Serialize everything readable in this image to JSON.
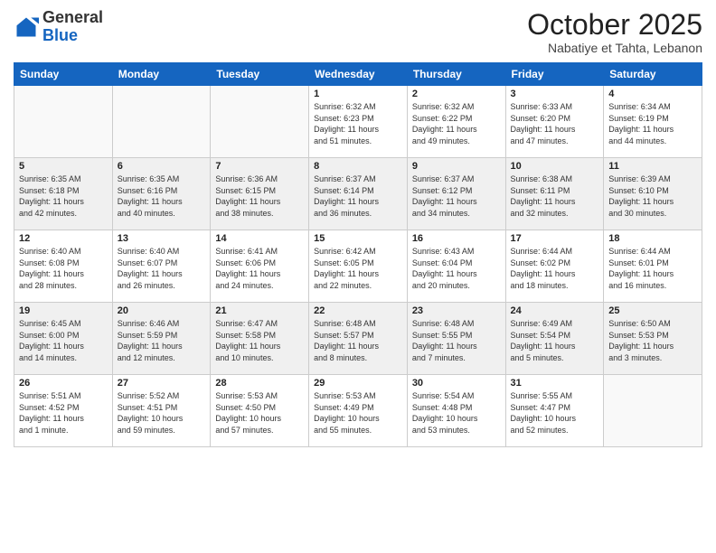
{
  "header": {
    "logo_general": "General",
    "logo_blue": "Blue",
    "month_title": "October 2025",
    "subtitle": "Nabatiye et Tahta, Lebanon"
  },
  "days_of_week": [
    "Sunday",
    "Monday",
    "Tuesday",
    "Wednesday",
    "Thursday",
    "Friday",
    "Saturday"
  ],
  "weeks": [
    {
      "shaded": false,
      "days": [
        {
          "number": "",
          "info": ""
        },
        {
          "number": "",
          "info": ""
        },
        {
          "number": "",
          "info": ""
        },
        {
          "number": "1",
          "info": "Sunrise: 6:32 AM\nSunset: 6:23 PM\nDaylight: 11 hours\nand 51 minutes."
        },
        {
          "number": "2",
          "info": "Sunrise: 6:32 AM\nSunset: 6:22 PM\nDaylight: 11 hours\nand 49 minutes."
        },
        {
          "number": "3",
          "info": "Sunrise: 6:33 AM\nSunset: 6:20 PM\nDaylight: 11 hours\nand 47 minutes."
        },
        {
          "number": "4",
          "info": "Sunrise: 6:34 AM\nSunset: 6:19 PM\nDaylight: 11 hours\nand 44 minutes."
        }
      ]
    },
    {
      "shaded": true,
      "days": [
        {
          "number": "5",
          "info": "Sunrise: 6:35 AM\nSunset: 6:18 PM\nDaylight: 11 hours\nand 42 minutes."
        },
        {
          "number": "6",
          "info": "Sunrise: 6:35 AM\nSunset: 6:16 PM\nDaylight: 11 hours\nand 40 minutes."
        },
        {
          "number": "7",
          "info": "Sunrise: 6:36 AM\nSunset: 6:15 PM\nDaylight: 11 hours\nand 38 minutes."
        },
        {
          "number": "8",
          "info": "Sunrise: 6:37 AM\nSunset: 6:14 PM\nDaylight: 11 hours\nand 36 minutes."
        },
        {
          "number": "9",
          "info": "Sunrise: 6:37 AM\nSunset: 6:12 PM\nDaylight: 11 hours\nand 34 minutes."
        },
        {
          "number": "10",
          "info": "Sunrise: 6:38 AM\nSunset: 6:11 PM\nDaylight: 11 hours\nand 32 minutes."
        },
        {
          "number": "11",
          "info": "Sunrise: 6:39 AM\nSunset: 6:10 PM\nDaylight: 11 hours\nand 30 minutes."
        }
      ]
    },
    {
      "shaded": false,
      "days": [
        {
          "number": "12",
          "info": "Sunrise: 6:40 AM\nSunset: 6:08 PM\nDaylight: 11 hours\nand 28 minutes."
        },
        {
          "number": "13",
          "info": "Sunrise: 6:40 AM\nSunset: 6:07 PM\nDaylight: 11 hours\nand 26 minutes."
        },
        {
          "number": "14",
          "info": "Sunrise: 6:41 AM\nSunset: 6:06 PM\nDaylight: 11 hours\nand 24 minutes."
        },
        {
          "number": "15",
          "info": "Sunrise: 6:42 AM\nSunset: 6:05 PM\nDaylight: 11 hours\nand 22 minutes."
        },
        {
          "number": "16",
          "info": "Sunrise: 6:43 AM\nSunset: 6:04 PM\nDaylight: 11 hours\nand 20 minutes."
        },
        {
          "number": "17",
          "info": "Sunrise: 6:44 AM\nSunset: 6:02 PM\nDaylight: 11 hours\nand 18 minutes."
        },
        {
          "number": "18",
          "info": "Sunrise: 6:44 AM\nSunset: 6:01 PM\nDaylight: 11 hours\nand 16 minutes."
        }
      ]
    },
    {
      "shaded": true,
      "days": [
        {
          "number": "19",
          "info": "Sunrise: 6:45 AM\nSunset: 6:00 PM\nDaylight: 11 hours\nand 14 minutes."
        },
        {
          "number": "20",
          "info": "Sunrise: 6:46 AM\nSunset: 5:59 PM\nDaylight: 11 hours\nand 12 minutes."
        },
        {
          "number": "21",
          "info": "Sunrise: 6:47 AM\nSunset: 5:58 PM\nDaylight: 11 hours\nand 10 minutes."
        },
        {
          "number": "22",
          "info": "Sunrise: 6:48 AM\nSunset: 5:57 PM\nDaylight: 11 hours\nand 8 minutes."
        },
        {
          "number": "23",
          "info": "Sunrise: 6:48 AM\nSunset: 5:55 PM\nDaylight: 11 hours\nand 7 minutes."
        },
        {
          "number": "24",
          "info": "Sunrise: 6:49 AM\nSunset: 5:54 PM\nDaylight: 11 hours\nand 5 minutes."
        },
        {
          "number": "25",
          "info": "Sunrise: 6:50 AM\nSunset: 5:53 PM\nDaylight: 11 hours\nand 3 minutes."
        }
      ]
    },
    {
      "shaded": false,
      "days": [
        {
          "number": "26",
          "info": "Sunrise: 5:51 AM\nSunset: 4:52 PM\nDaylight: 11 hours\nand 1 minute."
        },
        {
          "number": "27",
          "info": "Sunrise: 5:52 AM\nSunset: 4:51 PM\nDaylight: 10 hours\nand 59 minutes."
        },
        {
          "number": "28",
          "info": "Sunrise: 5:53 AM\nSunset: 4:50 PM\nDaylight: 10 hours\nand 57 minutes."
        },
        {
          "number": "29",
          "info": "Sunrise: 5:53 AM\nSunset: 4:49 PM\nDaylight: 10 hours\nand 55 minutes."
        },
        {
          "number": "30",
          "info": "Sunrise: 5:54 AM\nSunset: 4:48 PM\nDaylight: 10 hours\nand 53 minutes."
        },
        {
          "number": "31",
          "info": "Sunrise: 5:55 AM\nSunset: 4:47 PM\nDaylight: 10 hours\nand 52 minutes."
        },
        {
          "number": "",
          "info": ""
        }
      ]
    }
  ]
}
